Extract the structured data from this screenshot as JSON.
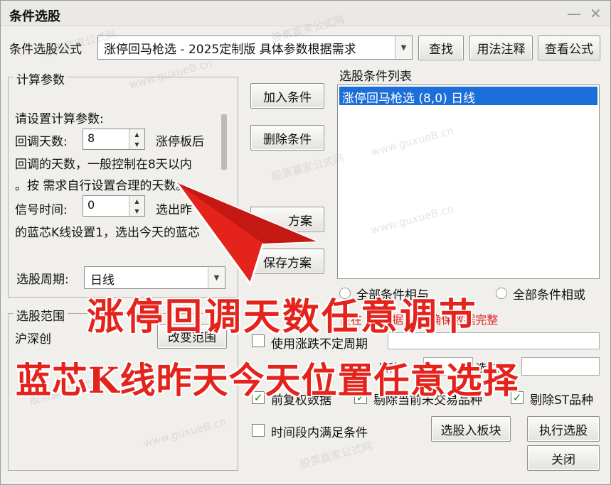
{
  "window": {
    "title": "条件选股",
    "minimize": "—",
    "close": "✕"
  },
  "formula": {
    "label": "条件选股公式",
    "value": "涨停回马枪选  -  2025定制版 具体参数根据需求",
    "search_btn": "查找",
    "usage_btn": "用法注释",
    "view_btn": "查看公式"
  },
  "params": {
    "group_label": "计算参数",
    "prompt": "请设置计算参数:",
    "p1_label": "回调天数:",
    "p1_value": "8",
    "p1_after": "涨停板后",
    "line2": "回调的天数，一般控制在8天以内",
    "line3": "。按 需求自行设置合理的天数。",
    "p2_label": "信号时间:",
    "p2_value": "0",
    "p2_after": "选出昨",
    "line5": "的蓝芯K线设置1，选出今天的蓝芯",
    "period_label": "选股周期:",
    "period_value": "日线"
  },
  "actions": {
    "add": "加入条件",
    "delete": "删除条件",
    "load": "方案",
    "save": "保存方案"
  },
  "conditions": {
    "label": "选股条件列表",
    "items": [
      "涨停回马枪选 (8,0) 日线"
    ],
    "radio_and": "全部条件相与",
    "radio_or": "全部条件相或"
  },
  "range": {
    "group_label": "选股范围",
    "value": "沪深创",
    "change_btn": "改变范围"
  },
  "warning": "设在        的         数据       行，确保数据完整",
  "options": {
    "uncertain_period": "使用涨跌不定周期",
    "variety_label": "品种",
    "selected_label": "选中数",
    "forward_adjust": "前复权数据",
    "exclude_untraded": "剔除当前未交易品种",
    "exclude_st": "剔除ST品种",
    "time_period": "时间段内满足条件"
  },
  "bottom": {
    "to_block": "选股入板块",
    "execute": "执行选股",
    "close": "关闭"
  },
  "overlay": {
    "line1": "涨停回调天数任意调节",
    "line2": "蓝芯K线昨天今天位置任意选择"
  },
  "watermark": {
    "a": "股票赢家公式网",
    "b": "www.guxueB.cn"
  }
}
